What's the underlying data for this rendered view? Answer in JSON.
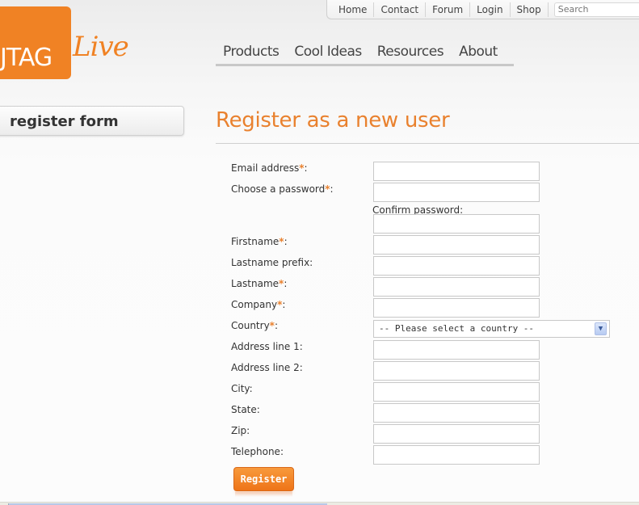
{
  "brand": {
    "logo_box_text": "JTAG",
    "logo_script_text": "Live",
    "brand_color": "#f08224"
  },
  "top_nav": {
    "links": [
      "Home",
      "Contact",
      "Forum",
      "Login",
      "Shop"
    ],
    "search_placeholder": "Search"
  },
  "main_nav": {
    "items": [
      "Products",
      "Cool Ideas",
      "Resources",
      "About"
    ]
  },
  "sidebar": {
    "title": "register form"
  },
  "page": {
    "title": "Register as a new user",
    "accent_color": "#e9812e"
  },
  "form": {
    "required_marker": "*",
    "fields": [
      {
        "label": "Email address",
        "required": true,
        "value": ""
      },
      {
        "label": "Choose a password",
        "required": true,
        "value": ""
      },
      {
        "label": "Firstname",
        "required": true,
        "value": ""
      },
      {
        "label": "Lastname prefix",
        "required": false,
        "value": ""
      },
      {
        "label": "Lastname",
        "required": true,
        "value": ""
      },
      {
        "label": "Company",
        "required": true,
        "value": ""
      },
      {
        "label": "Country",
        "required": true,
        "value": ""
      },
      {
        "label": "Address line 1",
        "required": false,
        "value": ""
      },
      {
        "label": "Address line 2",
        "required": false,
        "value": ""
      },
      {
        "label": "City",
        "required": false,
        "value": ""
      },
      {
        "label": "State",
        "required": false,
        "value": ""
      },
      {
        "label": "Zip",
        "required": false,
        "value": ""
      },
      {
        "label": "Telephone",
        "required": false,
        "value": ""
      }
    ],
    "confirm_password_label": "Confirm password:",
    "country_selected": "-- Please select a country --",
    "submit_label": "Register"
  }
}
